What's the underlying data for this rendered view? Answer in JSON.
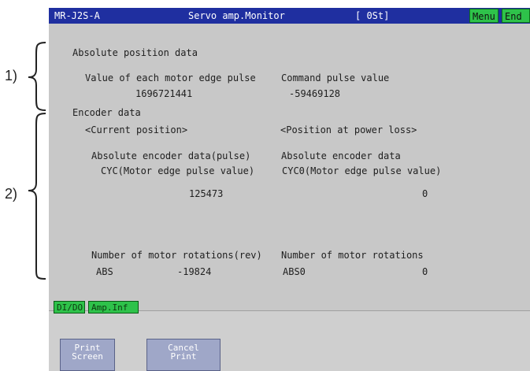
{
  "title_bar": {
    "model": "MR-J2S-A",
    "screen": "Servo amp.Monitor",
    "station": "[ 0St]",
    "menu_label": "Menu",
    "end_label": "End"
  },
  "section1": {
    "title": "Absolute position data",
    "col1_label": "Value of each motor edge pulse",
    "col2_label": "Command pulse value",
    "col1_value": "1696721441",
    "col2_value": "-59469128"
  },
  "section2": {
    "title": "Encoder data",
    "current_position": "<Current position>",
    "power_loss_position": "<Position at power loss>",
    "abs_enc_pulse_label": "Absolute encoder data(pulse)",
    "abs_enc_label": "Absolute encoder data",
    "cyc_label": "CYC(Motor edge pulse value)",
    "cyc0_label": "CYC0(Motor edge pulse value)",
    "cyc_value": "125473",
    "cyc0_value": "0",
    "rotations_rev_label": "Number of motor rotations(rev)",
    "rotations_label": "Number of motor rotations",
    "abs_label": "ABS",
    "abs_value": "-19824",
    "abs0_label": "ABS0",
    "abs0_value": "0"
  },
  "tabs": {
    "dido": "DI/DO",
    "amp_inf": "Amp.Inf"
  },
  "buttons": {
    "print_screen_line1": "Print",
    "print_screen_line2": "Screen",
    "cancel_print_line1": "Cancel",
    "cancel_print_line2": "Print"
  },
  "annotations": {
    "label1": "1)",
    "label2": "2)"
  },
  "colors": {
    "titlebar": "#1f2fa0",
    "button_green": "#2ec24a",
    "screen_bg": "#c8c8c8",
    "print_button": "#9fa7c8"
  }
}
